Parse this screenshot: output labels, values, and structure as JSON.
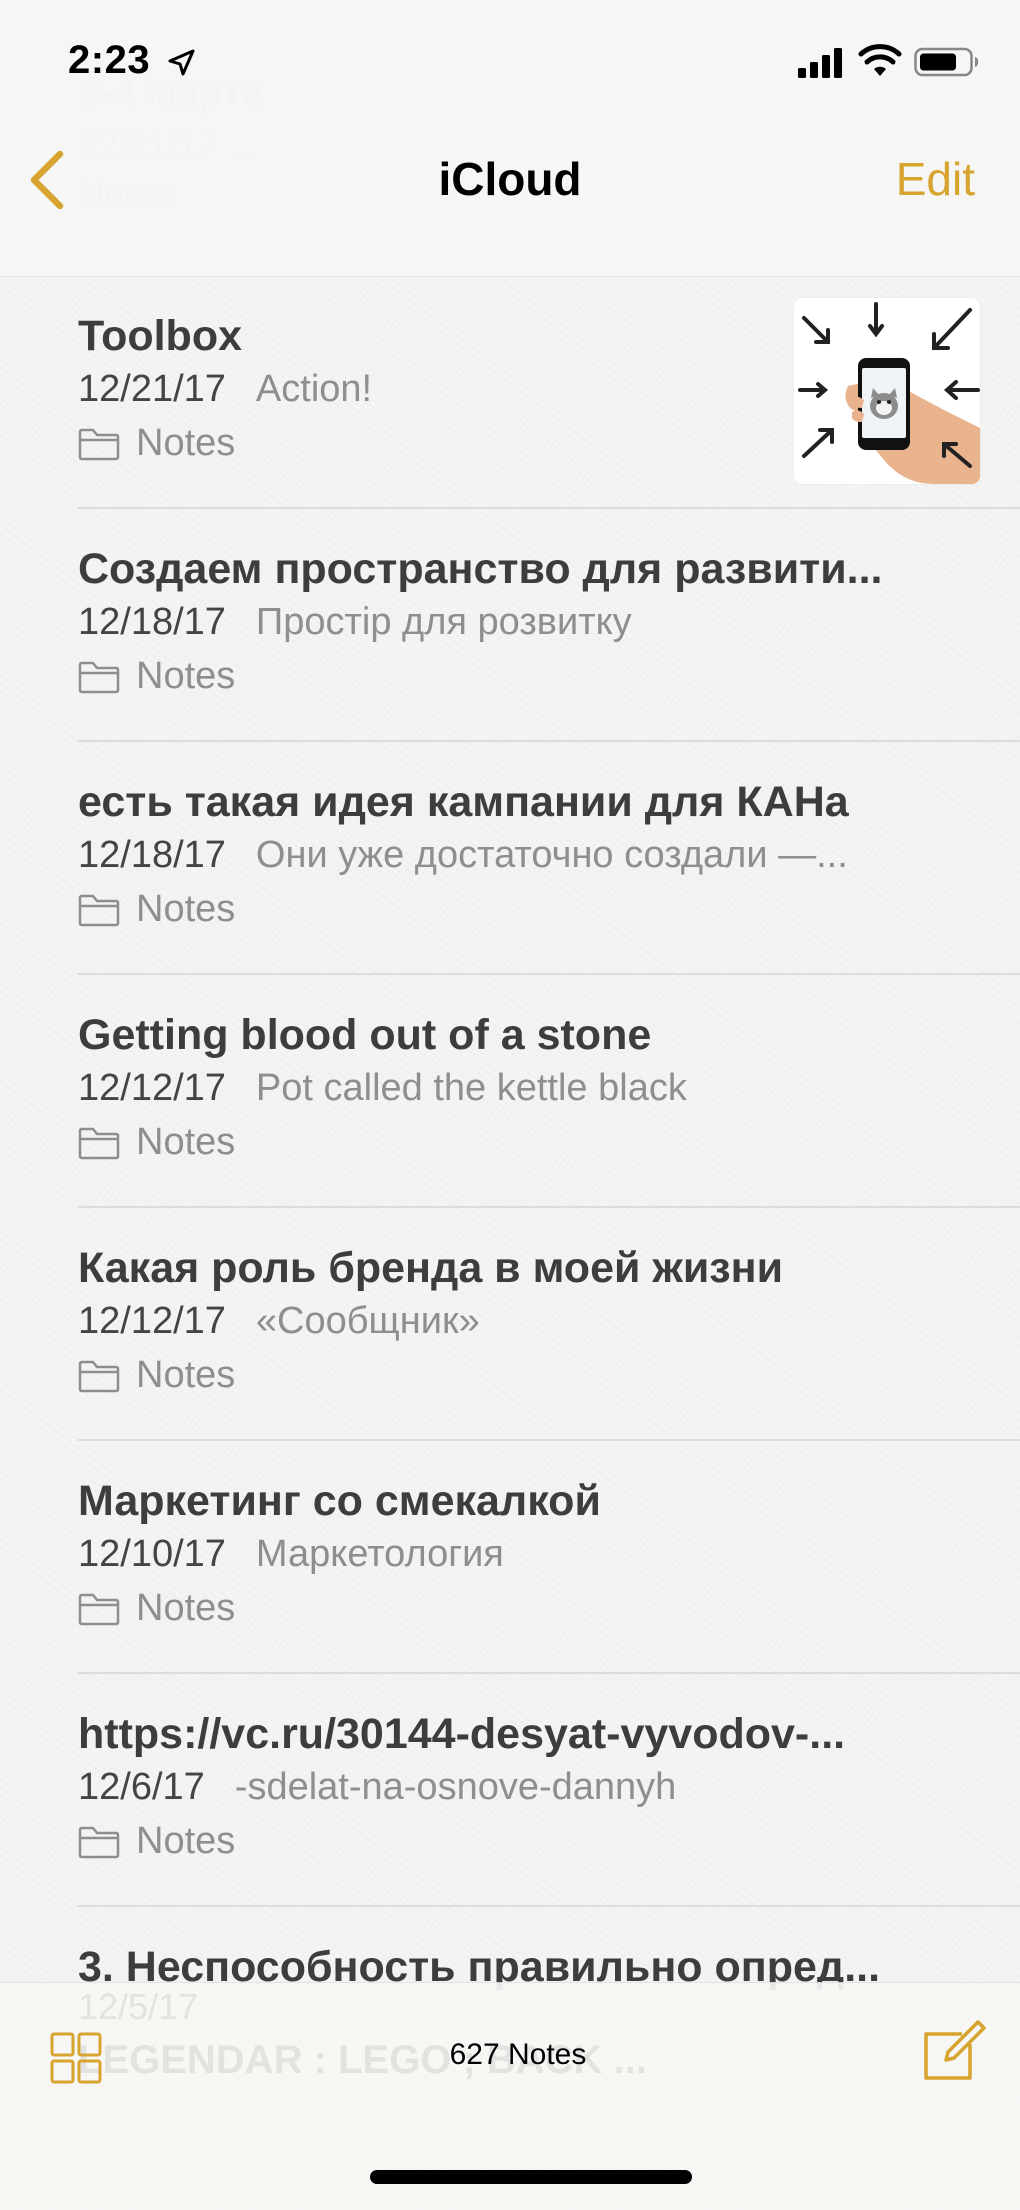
{
  "status_bar": {
    "time": "2:23"
  },
  "nav": {
    "title": "iCloud",
    "edit_label": "Edit",
    "ghost_title": "3-4 марта",
    "ghost_meta": "12/21/17   ...",
    "ghost_folder": "Notes"
  },
  "notes": [
    {
      "title": "Toolbox",
      "date": "12/21/17",
      "preview": "Action!",
      "folder": "Notes",
      "has_thumbnail": true
    },
    {
      "title": "Создаем пространство для развити...",
      "date": "12/18/17",
      "preview": "Простір для розвитку",
      "folder": "Notes"
    },
    {
      "title": "есть такая идея кампании для КАНа",
      "date": "12/18/17",
      "preview": "Они уже достаточно создали —...",
      "folder": "Notes"
    },
    {
      "title": "Getting blood out of a stone",
      "date": "12/12/17",
      "preview": "Pot called the kettle black",
      "folder": "Notes"
    },
    {
      "title": "Какая роль бренда в моей жизни",
      "date": "12/12/17",
      "preview": "«Сообщник»",
      "folder": "Notes"
    },
    {
      "title": "Маркетинг со смекалкой",
      "date": "12/10/17",
      "preview": "Маркетология",
      "folder": "Notes"
    },
    {
      "title": "https://vc.ru/30144-desyat-vyvodov-...",
      "date": "12/6/17",
      "preview": "-sdelat-na-osnove-dannyh",
      "folder": "Notes"
    },
    {
      "title": "3. Неспособность правильно опред...",
      "date": "",
      "preview": "",
      "folder": ""
    }
  ],
  "toolbar": {
    "count_label": "627 Notes",
    "ghost_title": "LEGENDAR : LEGO ; BACK ...",
    "ghost_meta": "12/5/17"
  },
  "colors": {
    "accent": "#d7a42f",
    "background": "#f4f4f2",
    "title_text": "#3d3d3d",
    "secondary_text": "#8e8e8e"
  },
  "icons": {
    "back": "chevron-left-icon",
    "folder": "folder-icon",
    "gallery": "gallery-grid-icon",
    "compose": "compose-icon",
    "location": "location-arrow-icon",
    "signal": "cellular-signal-icon",
    "wifi": "wifi-icon",
    "battery": "battery-icon"
  }
}
